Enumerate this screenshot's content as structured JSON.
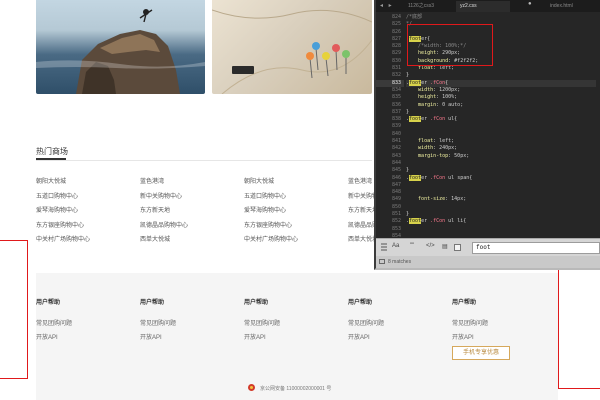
{
  "colors": {
    "accent_red": "#e0191b",
    "editor_bg": "#262626",
    "selector_pink": "#ff7a8f",
    "search_match": "#d7d24b",
    "mobile_button": "#b88a3f"
  },
  "webpage": {
    "section_title": "热门商场",
    "malls": [
      [
        "朝阳大悦城",
        "五道口购物中心",
        "爱琴海购物中心",
        "东方银座购物中心",
        "中关村广场购物中心"
      ],
      [
        "蓝色港湾",
        "新中关购物中心",
        "东方新天地",
        "凯德晶品购物中心",
        "西单大悦城"
      ],
      [
        "朝阳大悦城",
        "五道口购物中心",
        "爱琴海购物中心",
        "东方银座购物中心",
        "中关村广场购物中心"
      ],
      [
        "蓝色港湾",
        "新中关购物中心",
        "东方新天地",
        "凯德晶品购物中心",
        "西单大悦城"
      ]
    ],
    "footer": {
      "columns": [
        {
          "heading": "用户帮助",
          "links": [
            "常见团购问题",
            "开放API"
          ]
        },
        {
          "heading": "用户帮助",
          "links": [
            "常见团购问题",
            "开放API"
          ]
        },
        {
          "heading": "用户帮助",
          "links": [
            "常见团购问题",
            "开放API"
          ]
        },
        {
          "heading": "用户帮助",
          "links": [
            "常见团购问题",
            "开放API"
          ]
        },
        {
          "heading": "用户帮助",
          "links": [
            "常见团购问题",
            "开放API"
          ]
        }
      ],
      "mobile_button": "手机专享优惠",
      "icp": "京公网安备 11000002000001 号"
    }
  },
  "editor": {
    "nav": "◂ ▸",
    "tabs": [
      {
        "label": "1126之css3",
        "active": false
      },
      {
        "label": "yz2.css",
        "active": true
      },
      {
        "label": "index.html",
        "active": false
      }
    ],
    "lines": [
      {
        "n": "824",
        "t": "/*底部",
        "kind": "comment"
      },
      {
        "n": "825",
        "t": "*/",
        "kind": "comment"
      },
      {
        "n": "826",
        "t": "",
        "kind": "blank"
      },
      {
        "n": "827",
        "t": ".footer{",
        "kind": "selector"
      },
      {
        "n": "828",
        "t": "    /*width: 100%;*/",
        "kind": "comment"
      },
      {
        "n": "829",
        "t": "    height: 290px;",
        "kind": "prop"
      },
      {
        "n": "830",
        "t": "    background: #f2f2f2;",
        "kind": "prop"
      },
      {
        "n": "831",
        "t": "    float: left;",
        "kind": "prop"
      },
      {
        "n": "832",
        "t": "}",
        "kind": "brace"
      },
      {
        "n": "833",
        "t": ".footer .fCon{",
        "kind": "selector",
        "hl": true
      },
      {
        "n": "834",
        "t": "    width: 1200px;",
        "kind": "prop"
      },
      {
        "n": "835",
        "t": "    height: 100%;",
        "kind": "prop"
      },
      {
        "n": "836",
        "t": "    margin: 0 auto;",
        "kind": "prop"
      },
      {
        "n": "837",
        "t": "}",
        "kind": "brace"
      },
      {
        "n": "838",
        "t": ".footer .fCon ul{",
        "kind": "selector"
      },
      {
        "n": "839",
        "t": "",
        "kind": "blank"
      },
      {
        "n": "840",
        "t": "",
        "kind": "blank"
      },
      {
        "n": "841",
        "t": "    float: left;",
        "kind": "prop"
      },
      {
        "n": "842",
        "t": "    width: 240px;",
        "kind": "prop"
      },
      {
        "n": "843",
        "t": "    margin-top: 50px;",
        "kind": "prop"
      },
      {
        "n": "844",
        "t": "",
        "kind": "blank"
      },
      {
        "n": "845",
        "t": "}",
        "kind": "brace"
      },
      {
        "n": "846",
        "t": ".footer .fCon ul span{",
        "kind": "selector"
      },
      {
        "n": "847",
        "t": "",
        "kind": "blank"
      },
      {
        "n": "848",
        "t": "",
        "kind": "blank"
      },
      {
        "n": "849",
        "t": "    font-size: 14px;",
        "kind": "prop"
      },
      {
        "n": "850",
        "t": "",
        "kind": "blank"
      },
      {
        "n": "851",
        "t": "}",
        "kind": "brace"
      },
      {
        "n": "852",
        "t": ".footer .fCon ul li{",
        "kind": "selector"
      },
      {
        "n": "853",
        "t": "",
        "kind": "blank"
      },
      {
        "n": "854",
        "t": "",
        "kind": "blank"
      },
      {
        "n": "855",
        "t": "    list-style: none;",
        "kind": "prop"
      },
      {
        "n": "856",
        "t": "    font-size: 12px;",
        "kind": "prop"
      }
    ],
    "find": {
      "options": [
        "Aa",
        "\"\"",
        "</>"
      ],
      "query": "foot"
    },
    "status": "8 matches"
  }
}
